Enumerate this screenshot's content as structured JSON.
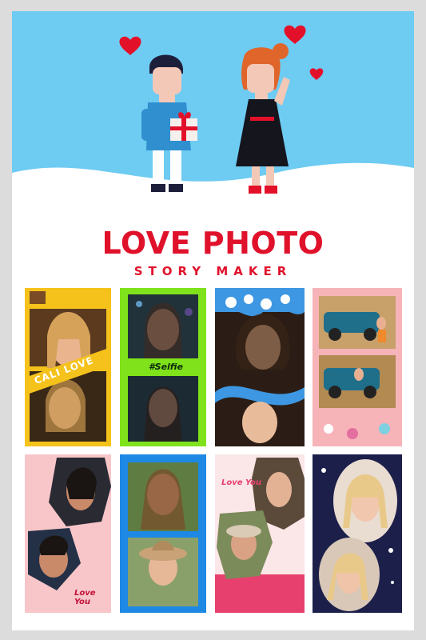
{
  "app": {
    "title": "LOVE PHOTO",
    "subtitle": "STORY MAKER"
  },
  "colors": {
    "sky": "#6ecbf2",
    "accent_red": "#e0122b",
    "background": "#dcdcdc"
  },
  "templates": [
    {
      "id": "tpl-1",
      "caption": "CALI LOVE",
      "frame_color": "#f5c21b"
    },
    {
      "id": "tpl-2",
      "caption": "#Selfie",
      "frame_color": "#7fe21a"
    },
    {
      "id": "tpl-3",
      "caption": "",
      "frame_color": "#2a8fdc"
    },
    {
      "id": "tpl-4",
      "caption": "",
      "frame_color": "#f6b3b8"
    },
    {
      "id": "tpl-5",
      "caption": "Love You",
      "frame_color": "#f8c6c9"
    },
    {
      "id": "tpl-6",
      "caption": "",
      "frame_color": "#1e88e5"
    },
    {
      "id": "tpl-7",
      "caption": "Love You",
      "frame_color": "#e8406e"
    },
    {
      "id": "tpl-8",
      "caption": "",
      "frame_color": "#1c1f4a"
    }
  ]
}
